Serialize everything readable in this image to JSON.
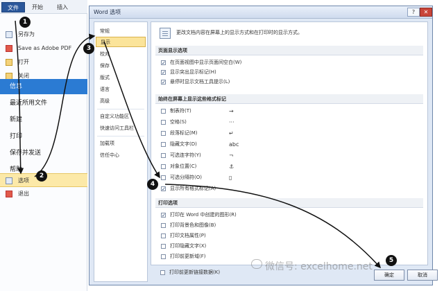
{
  "ribbon": {
    "tabs": [
      "文件",
      "开始",
      "插入"
    ]
  },
  "backstage": {
    "items": [
      "另存为",
      "Save as Adobe PDF",
      "打开",
      "关闭"
    ],
    "categories": [
      "信息",
      "最近所用文件",
      "新建",
      "打印",
      "保存并发送",
      "帮助"
    ],
    "options_label": "选项",
    "exit_label": "退出"
  },
  "dialog": {
    "title": "Word 选项",
    "help_label": "?",
    "close_label": "✕",
    "nav": [
      "常规",
      "显示",
      "校对",
      "保存",
      "版式",
      "语言",
      "高级",
      "自定义功能区",
      "快速访问工具栏",
      "加载项",
      "信任中心"
    ],
    "description": "更改文档内容在屏幕上的显示方式和在打印时的显示方式。",
    "sections": {
      "page_display": "页面显示选项",
      "marks": "始终在屏幕上显示这些格式标记",
      "print": "打印选项"
    },
    "page_display_options": [
      {
        "label": "在页面视图中显示页面间空白(W)",
        "checked": true
      },
      {
        "label": "显示突出显示标记(H)",
        "checked": true
      },
      {
        "label": "悬停时显示文档工具提示(L)",
        "checked": true
      }
    ],
    "mark_options": [
      {
        "label": "制表符(T)",
        "symbol": "→",
        "checked": false
      },
      {
        "label": "空格(S)",
        "symbol": "···",
        "checked": false
      },
      {
        "label": "段落标记(M)",
        "symbol": "↵",
        "checked": false
      },
      {
        "label": "隐藏文字(D)",
        "symbol": "abc",
        "checked": false
      },
      {
        "label": "可选连字符(Y)",
        "symbol": "¬",
        "checked": false
      },
      {
        "label": "对象位置(C)",
        "symbol": "⚓",
        "checked": false
      },
      {
        "label": "可选分隔符(O)",
        "symbol": "▯",
        "checked": false
      },
      {
        "label": "显示所有格式标记(A)",
        "symbol": "",
        "checked": true
      }
    ],
    "print_options": [
      {
        "label": "打印在 Word 中创建的图形(R)",
        "checked": true
      },
      {
        "label": "打印背景色和图像(B)",
        "checked": false
      },
      {
        "label": "打印文档属性(P)",
        "checked": false
      },
      {
        "label": "打印隐藏文字(X)",
        "checked": false
      },
      {
        "label": "打印前更新域(F)",
        "checked": false
      },
      {
        "label": "打印前更新链接数据(K)",
        "checked": false
      }
    ],
    "ok_label": "确定",
    "cancel_label": "取消"
  },
  "steps": [
    "1",
    "2",
    "3",
    "4",
    "5"
  ],
  "watermark": "微信号: excelhome.net"
}
